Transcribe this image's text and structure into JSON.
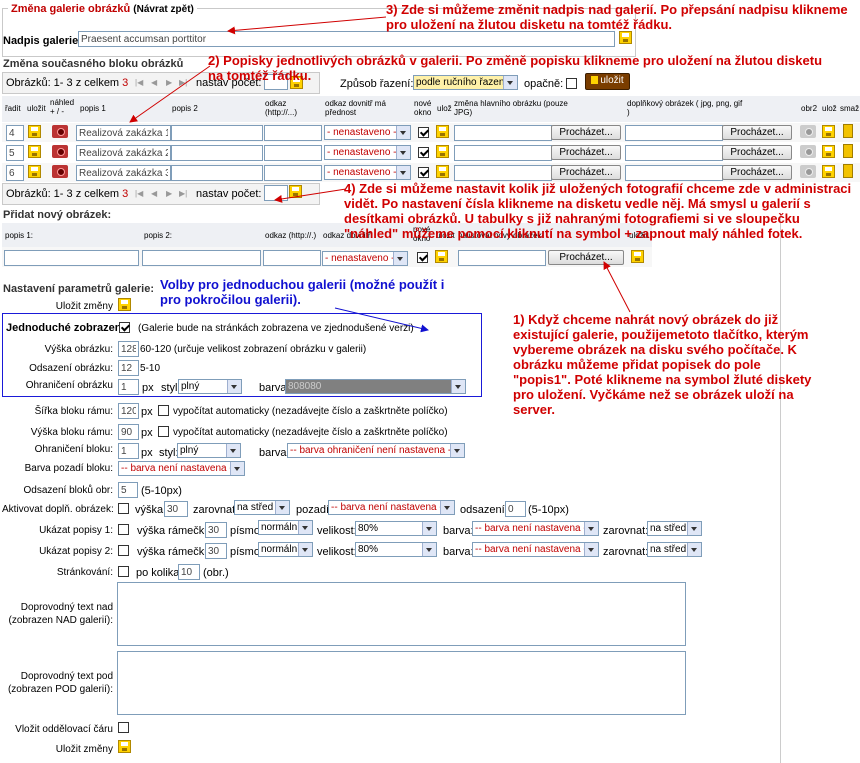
{
  "header": {
    "title": "Změna galerie obrázků",
    "back_link": "(Návrat zpět)"
  },
  "gallery_title": {
    "label": "Nadpis galerie:",
    "value": "Praesent accumsan porttitor"
  },
  "current_block": {
    "heading": "Změna současného bloku obrázků",
    "pager_text_prefix": "Obrázků: 1- 3 z celkem",
    "pager_total": "3",
    "set_count_label": "nastav počet:",
    "sort_label": "Způsob řazení:",
    "sort_value": "podle ručního řazení",
    "reverse_label": "opačně:",
    "save_button": "uložit",
    "columns": {
      "order": "řadit",
      "save": "uložit",
      "preview": "náhled + / -",
      "desc1": "popis 1",
      "desc2": "popis 2",
      "link": "odkaz (http://...)",
      "link_inside": "odkaz dovnitř má přednost",
      "new_window": "nové okno",
      "save2": "ulož",
      "main_image": "změna hlavního obrázku (pouze JPG)",
      "extra_image": "doplňkový obrázek ( jpg, png, gif )",
      "img2": "obr2",
      "save3": "ulož",
      "delete": "smaž"
    },
    "rows": [
      {
        "order": "4",
        "desc1": "Realizová zakázka 1",
        "link_inside": "- nenastaveno -",
        "browse": "Procházet...",
        "browse2": "Procházet..."
      },
      {
        "order": "5",
        "desc1": "Realizová zakázka 2",
        "link_inside": "- nenastaveno -",
        "browse": "Procházet...",
        "browse2": "Procházet..."
      },
      {
        "order": "6",
        "desc1": "Realizová zakázka 3",
        "link_inside": "- nenastaveno -",
        "browse": "Procházet...",
        "browse2": "Procházet..."
      }
    ]
  },
  "new_image": {
    "heading": "Přidat nový obrázek:",
    "columns": {
      "desc1": "popis 1:",
      "desc2": "popis 2:",
      "link": "odkaz (http://.)",
      "link_inside": "odkaz dovnitř",
      "new_window": "nové okno",
      "save": "uložit",
      "upload": "nalistovat nový obrázek:",
      "save2": "uložit"
    },
    "link_inside": "- nenastaveno -",
    "browse": "Procházet..."
  },
  "params": {
    "heading": "Nastavení parametrů galerie:",
    "save_changes": "Uložit změny",
    "simple_label": "Jednoduché zobrazení",
    "simple_note": "(Galerie bude na stránkách zobrazena ve zjednodušené verzi)",
    "img_height_label": "Výška obrázku:",
    "img_height": "128",
    "img_height_note": "60-120 (určuje velikost zobrazení obrázku v galerii)",
    "img_offset_label": "Odsazení obrázku:",
    "img_offset": "12",
    "img_offset_note": "5-10",
    "img_border_label": "Ohraničení obrázku",
    "img_border": "1",
    "px": "px",
    "style_label": "styl:",
    "style_value": "plný",
    "color_label": "barva:",
    "img_border_color": "808080",
    "frame_width_label": "Šířka bloku rámu:",
    "frame_width": "120",
    "auto_width_note": "vypočítat automaticky (nezadávejte číslo a zaškrtněte políčko)",
    "frame_height_label": "Výška bloku rámu:",
    "frame_height": "90",
    "auto_height_note": "vypočítat automaticky (nezadávejte číslo a zaškrtněte políčko)",
    "block_border_label": "Ohraničení bloku:",
    "block_border": "1",
    "block_style": "plný",
    "block_border_color": "-- barva ohraničení není nastavena --",
    "bg_label": "Barva pozadí bloku:",
    "bg_value": "-- barva není nastavena -",
    "block_offset_label": "Odsazení bloků obr:",
    "block_offset": "5",
    "block_offset_note": "(5-10px)",
    "extra_label": "Aktivovat doplň. obrázek:",
    "extra_height_label": "výška:",
    "extra_height": "30",
    "align_label": "zarovnat:",
    "align_center": "na střed",
    "bg2_label": "pozadí:",
    "bg2_value": "-- barva není nastavena -",
    "extra_offset_label": "odsazení:",
    "extra_offset": "0",
    "extra_offset_note": "(5-10px)",
    "show_desc1_label": "Ukázat popisy 1:",
    "frame_h_label": "výška rámečku:",
    "desc_frame_h": "30",
    "font_label": "písmo:",
    "font_value": "normální",
    "size_label": "velikost:",
    "size_value": "80%",
    "color2_label": "barva:",
    "color_unset": "-- barva není nastavena -",
    "align2_label": "zarovnat:",
    "show_desc2_label": "Ukázat popisy 2:",
    "paging_label": "Stránkování:",
    "per_page_label": "po kolika:",
    "per_page": "10",
    "per_page_note": "(obr.)",
    "text_above_label": "Doprovodný text nad (zobrazen NAD galerií):",
    "text_below_label": "Doprovodný text pod (zobrazen POD galerií):",
    "separator_label": "Vložit oddělovací čáru",
    "save_changes2": "Uložit změny"
  },
  "annotations": {
    "a3": "3) Zde si můžeme změnit nadpis nad galerií. Po přepsání nadpisu klikneme pro uložení na žlutou disketu na tomtéž řádku.",
    "a2": "2) Popisky jednotlivých obrázků v galerii. Po změně popisku klikneme pro uložení na žlutou disketu na tomtéž řádku.",
    "a4": "4) Zde si můžeme nastavit kolik již uložených fotografií chceme zde v administraci vidět. Po nastavení čísla klikneme na disketu vedle něj. Má smysl u galerií s desítkami obrázků. U tabulky s již nahranými fotografiemi si ve sloupečku \"náhled\" můžeme pomocí kliknutí na symbol + zapnout malý náhled fotek.",
    "a1": "1) Když chceme nahrát nový obrázek do již existující galerie, použijemetoto tlačítko, kterým vybereme obrázek na disku svého počítače. K obrázku můžeme přidat popisek do pole \"popis1\". Poté klikneme na symbol žluté diskety pro uložení. Vyčkáme než se obrázek uloží na server.",
    "blue": "Volby pro jednoduchou galerii (možné použít i pro pokročilou galerii)."
  },
  "colors": {
    "accent_red": "#c00000",
    "annotation_red": "#d00000",
    "annotation_blue": "#1010d0",
    "disk_yellow": "#ffd200",
    "save_orange": "#7a3d00"
  }
}
